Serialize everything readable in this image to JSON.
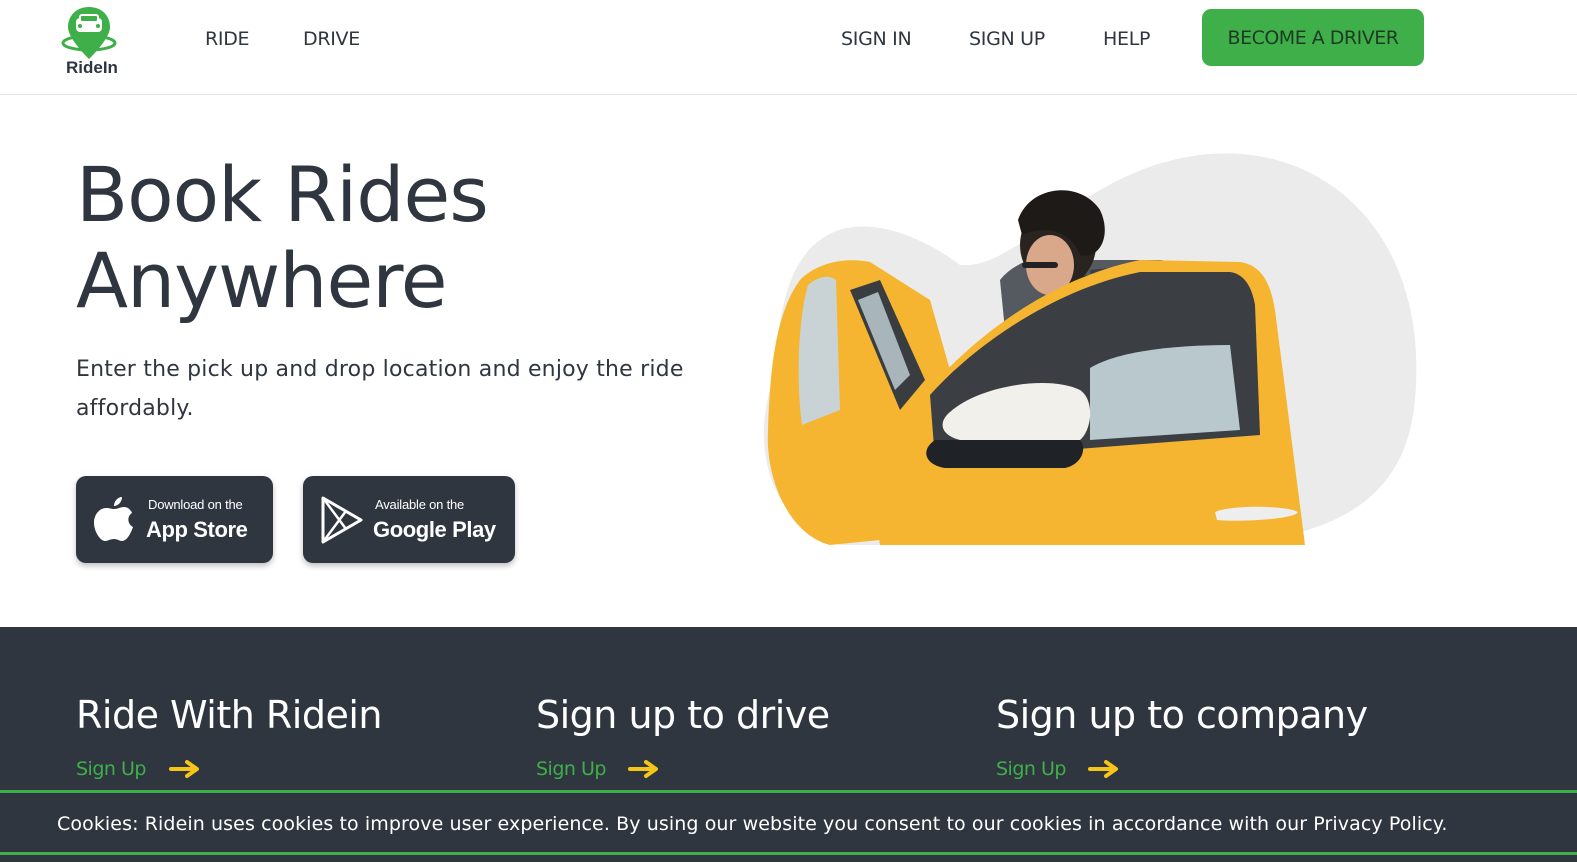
{
  "brand": {
    "name": "RideIn",
    "color": "#3fb049"
  },
  "nav": {
    "left": [
      "RIDE",
      "DRIVE"
    ],
    "right": [
      "SIGN IN",
      "SIGN UP",
      "HELP"
    ],
    "cta": "BECOME A DRIVER"
  },
  "hero": {
    "title_line1": "Book Rides",
    "title_line2": "Anywhere",
    "subtitle": "Enter the pick up and drop location and enjoy the ride affordably.",
    "app_store": {
      "small": "Download on the",
      "big": "App Store",
      "icon": "apple-icon"
    },
    "google_play": {
      "small": "Available on the",
      "big": "Google Play",
      "icon": "play-icon"
    }
  },
  "signup_cards": [
    {
      "title": "Ride With Ridein",
      "link": "Sign Up"
    },
    {
      "title": "Sign up to drive",
      "link": "Sign Up"
    },
    {
      "title": "Sign up to company",
      "link": "Sign Up"
    }
  ],
  "cookie": {
    "text": "Cookies: Ridein uses cookies to improve user experience. By using our website you consent to our cookies in accordance with our Privacy Policy."
  },
  "colors": {
    "dark": "#2f3640",
    "accent_green": "#3fb049",
    "arrow_yellow": "#f5c518",
    "taxi_yellow": "#f5b530"
  }
}
